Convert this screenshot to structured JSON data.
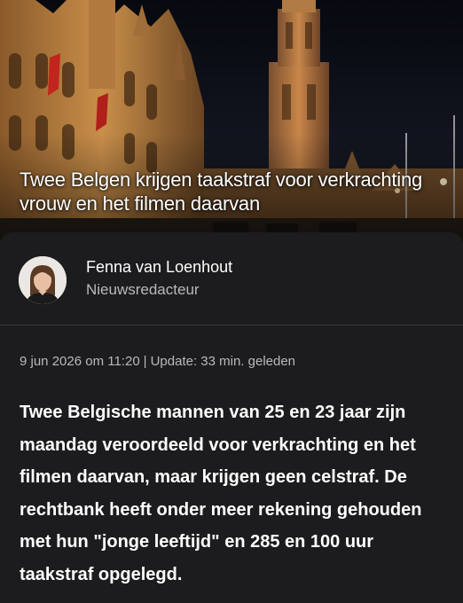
{
  "article": {
    "title": "Twee Belgen krijgen taakstraf voor verkrachting vrouw en het filmen daarvan",
    "lead": "Twee Belgische mannen van 25 en 23 jaar zijn maandag veroordeeld voor verkrachting en het filmen daarvan, maar krijgen geen celstraf. De rechtbank heeft onder meer rekening gehouden met hun \"jonge leeftijd\" en 285 en 100 uur taakstraf opgelegd."
  },
  "author": {
    "name": "Fenna van Loenhout",
    "role": "Nieuwsredacteur"
  },
  "meta": {
    "date": "9 jun 2026 om 11:20",
    "separator": "|",
    "update": "Update: 33 min. geleden"
  },
  "colors": {
    "background": "#1c1c1e",
    "secondary_text": "#b9b9bd",
    "divider": "#3a3a3e"
  }
}
